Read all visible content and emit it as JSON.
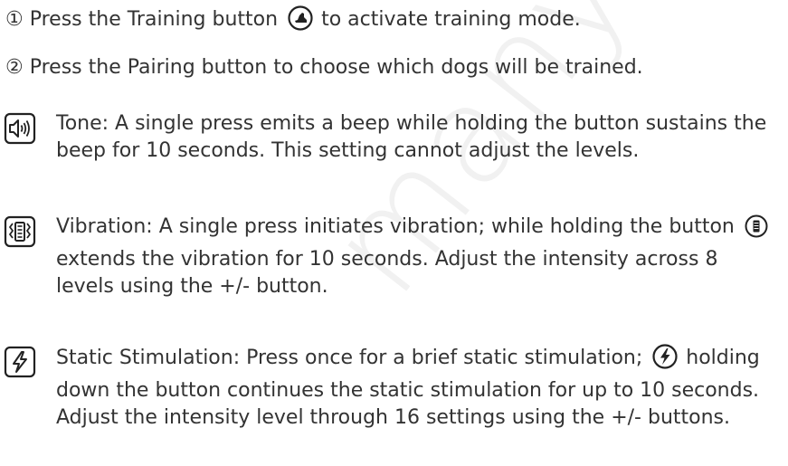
{
  "watermark": "manyeoft.c",
  "steps": [
    {
      "num": "①",
      "before": " Press the Training button ",
      "after": " to activate training mode."
    },
    {
      "num": "②",
      "text": " Press the Pairing button to choose which dogs will be trained."
    }
  ],
  "features": {
    "tone": {
      "icon": "speaker-icon",
      "text": "Tone: A single press emits a beep while holding the button sustains the beep for 10 seconds. This setting cannot adjust the levels."
    },
    "vibration": {
      "icon": "vibration-icon",
      "before": "Vibration: A single press initiates vibration; while holding the button ",
      "after": " extends the vibration for 10 seconds. Adjust the intensity across 8 levels using the +/- button."
    },
    "static": {
      "icon": "lightning-icon",
      "before": "Static Stimulation: Press once for a brief static stimulation; ",
      "after": " holding down the button continues the static stimulation for up to 10 seconds. Adjust the intensity level through 16 settings using the +/- buttons."
    }
  },
  "colors": {
    "text": "#333333",
    "watermark": "#f1f1f1"
  }
}
